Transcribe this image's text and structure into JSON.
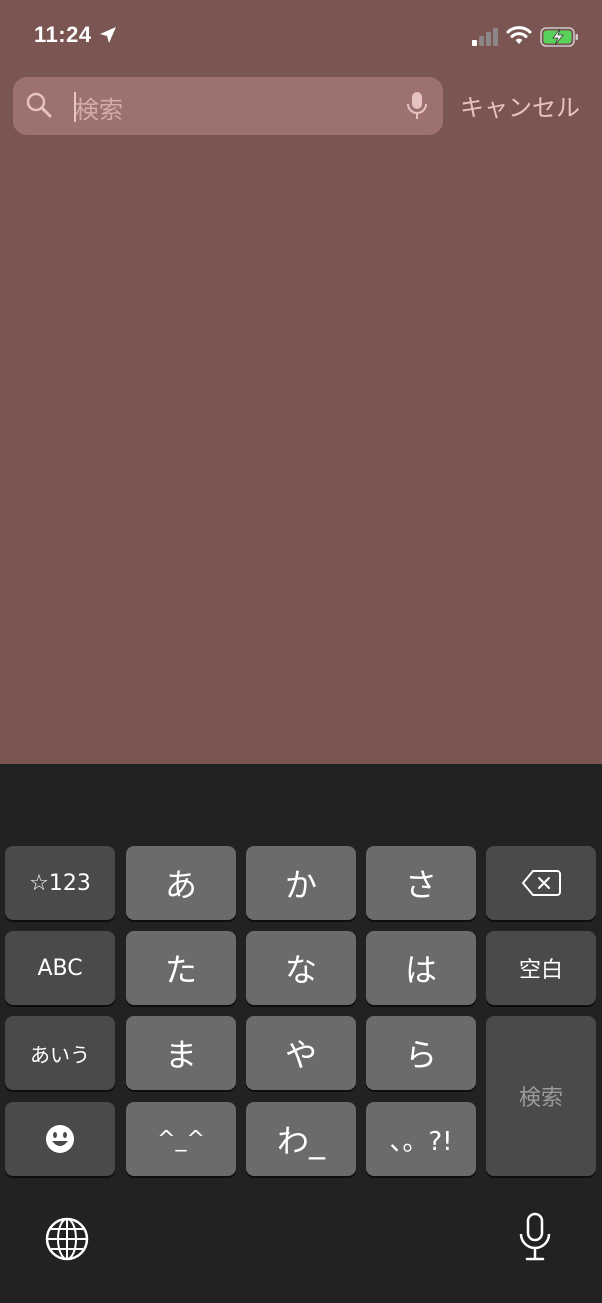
{
  "status_bar": {
    "time": "11:24"
  },
  "search": {
    "placeholder": "検索",
    "cancel_label": "キャンセル"
  },
  "keyboard": {
    "rows": [
      [
        "☆123",
        "あ",
        "か",
        "さ",
        "⌫"
      ],
      [
        "ABC",
        "た",
        "な",
        "は",
        "空白"
      ],
      [
        "あいう",
        "ま",
        "や",
        "ら",
        "検索"
      ],
      [
        "☻",
        "^_^",
        "わ_",
        "、。?!"
      ]
    ],
    "keys": {
      "numbers": "☆123",
      "a": "あ",
      "ka": "か",
      "sa": "さ",
      "abc": "ABC",
      "ta": "た",
      "na": "な",
      "ha": "は",
      "space": "空白",
      "aiu": "あいう",
      "ma": "ま",
      "ya": "や",
      "ra": "ら",
      "search": "検索",
      "kaomoji": "^_^",
      "wa": "わ_",
      "punctuation": "、。?!"
    }
  }
}
